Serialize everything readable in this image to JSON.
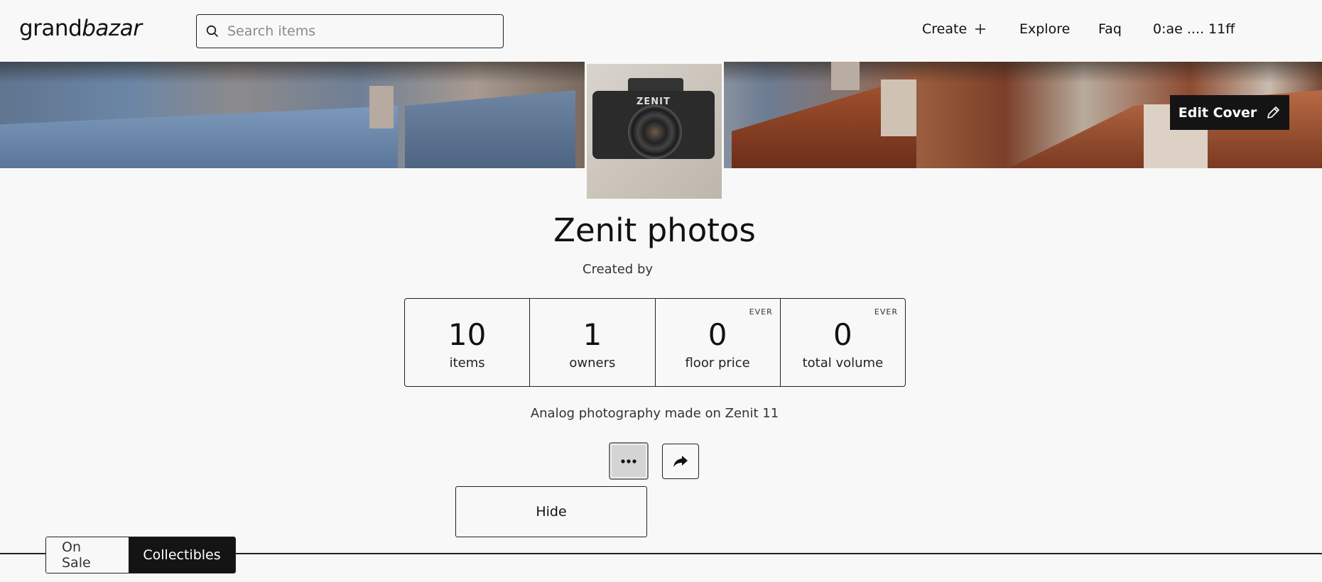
{
  "header": {
    "logo_prefix": "grand",
    "logo_suffix": "bazar",
    "search_placeholder": "Search items",
    "nav": {
      "create": "Create",
      "explore": "Explore",
      "faq": "Faq",
      "wallet": "0:ae .... 11ff"
    }
  },
  "cover": {
    "edit_label": "Edit Cover"
  },
  "collection": {
    "title": "Zenit photos",
    "created_by": "Created by",
    "description": "Analog photography made on Zenit 11",
    "camera_brand": "ZENIT"
  },
  "stats": [
    {
      "value": "10",
      "label": "items",
      "badge": ""
    },
    {
      "value": "1",
      "label": "owners",
      "badge": ""
    },
    {
      "value": "0",
      "label": "floor price",
      "badge": "EVER"
    },
    {
      "value": "0",
      "label": "total volume",
      "badge": "EVER"
    }
  ],
  "menu": {
    "hide_label": "Hide"
  },
  "tabs": {
    "on_sale": "On Sale",
    "collectibles": "Collectibles"
  },
  "icons": {
    "search": "search-icon",
    "create": "plus-icon",
    "edit": "pencil-icon",
    "more": "ellipsis-icon",
    "share": "share-arrow-icon"
  },
  "colors": {
    "background": "#f8f8f8",
    "primary_dark": "#141414",
    "border": "#222222"
  }
}
